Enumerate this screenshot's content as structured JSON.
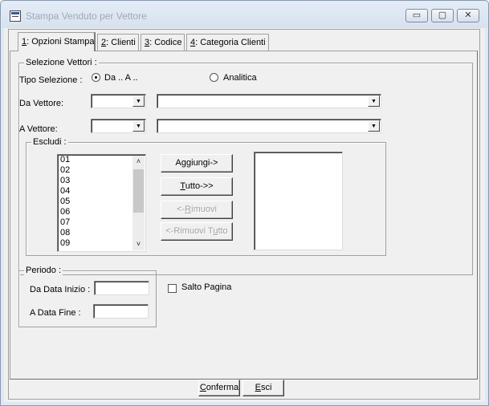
{
  "window": {
    "title": "Stampa Venduto per Vettore",
    "minimize_glyph": "▭",
    "maximize_glyph": "▢",
    "close_glyph": "✕"
  },
  "tabs": [
    {
      "key": "1",
      "label": ": Opzioni Stampa",
      "active": true
    },
    {
      "key": "2",
      "label": ": Clienti"
    },
    {
      "key": "3",
      "label": ": Codice"
    },
    {
      "key": "4",
      "label": ": Categoria Clienti"
    }
  ],
  "selezione": {
    "group_label": "Selezione Vettori :",
    "tipo_label": "Tipo Selezione :",
    "radio_range": "Da .. A ..",
    "radio_range_selected": true,
    "radio_analitica": "Analitica",
    "da_vettore_label": "Da Vettore:",
    "a_vettore_label": "A Vettore:",
    "da_code": "",
    "da_desc": "",
    "a_code": "",
    "a_desc": ""
  },
  "escludi": {
    "group_label": "Escludi :",
    "available": [
      "01",
      "02",
      "03",
      "04",
      "05",
      "06",
      "07",
      "08",
      "09"
    ],
    "selected": [],
    "buttons": {
      "add": "Aggiungi->",
      "add_all_key": "T",
      "add_all_rest": "utto->>",
      "remove_prefix": "<-",
      "remove_key": "R",
      "remove_rest": "imuovi",
      "remove_all_prefix": "<-Rimuovi T",
      "remove_all_key": "u",
      "remove_all_rest": "tto"
    }
  },
  "periodo": {
    "group_label": "Periodo :",
    "start_label": "Da Data Inizio :",
    "end_label": "A Data Fine :",
    "start_value": "",
    "end_value": ""
  },
  "salto_pagina": {
    "label": "Salto Pagina",
    "checked": false
  },
  "footer": {
    "confirm_key": "C",
    "confirm_rest": "onferma",
    "exit_key": "E",
    "exit_rest": "sci"
  }
}
